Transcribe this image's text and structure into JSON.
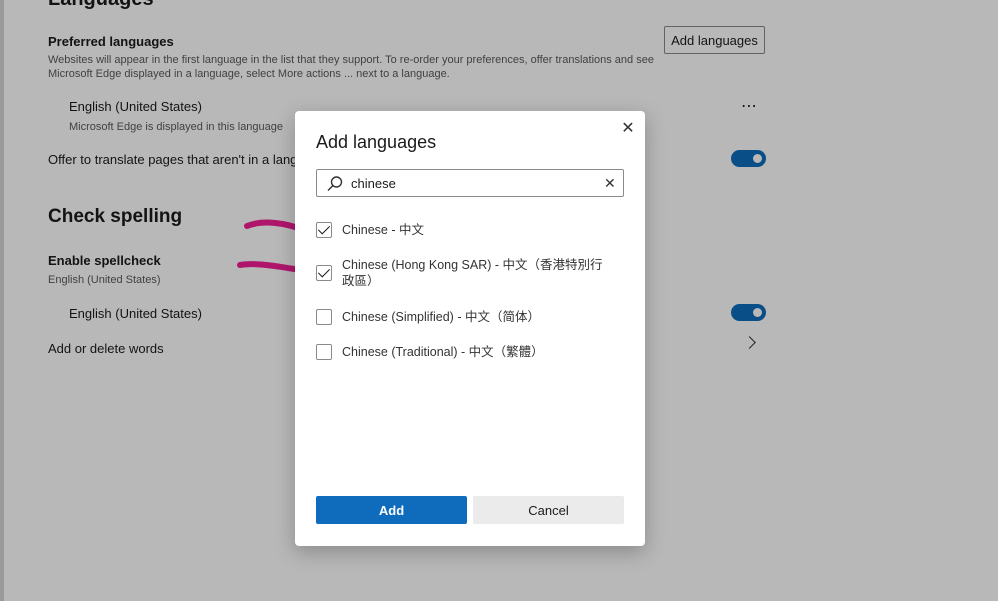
{
  "settings": {
    "languages_heading": "Languages",
    "preferred_languages_label": "Preferred languages",
    "preferred_languages_desc_line1": "Websites will appear in the first language in the list that they support. To re-order your preferences, offer translations and see",
    "preferred_languages_desc_line2": "Microsoft Edge displayed in a language, select More actions ... next to a language.",
    "add_languages_button": "Add languages",
    "english_us": "English (United States)",
    "english_us_desc": "Microsoft Edge is displayed in this language",
    "more_actions": "⋯",
    "offer_translate_label": "Offer to translate pages that aren't in a langu",
    "check_spelling_heading": "Check spelling",
    "enable_spellcheck_label": "Enable spellcheck",
    "enable_spellcheck_desc": "English (United States)",
    "spell_english_us": "English (United States)",
    "add_delete_words": "Add or delete words"
  },
  "dialog": {
    "title": "Add languages",
    "close_glyph": "✕",
    "search_value": "chinese",
    "clear_glyph": "✕",
    "options": [
      {
        "label": "Chinese - 中文",
        "checked": true
      },
      {
        "label": "Chinese (Hong Kong SAR) - 中文（香港特別行政區）",
        "checked": true
      },
      {
        "label": "Chinese (Simplified) - 中文（简体）",
        "checked": false
      },
      {
        "label": "Chinese (Traditional) - 中文（繁體）",
        "checked": false
      }
    ],
    "add_button": "Add",
    "cancel_button": "Cancel"
  },
  "colors": {
    "accent": "#0f6cbd",
    "annotation": "#b0156c"
  }
}
